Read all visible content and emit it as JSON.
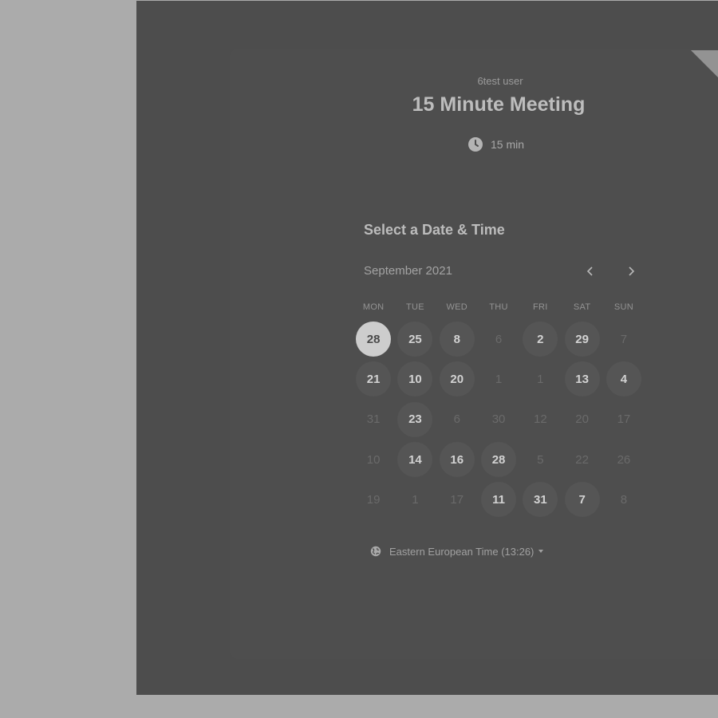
{
  "header": {
    "user_name": "6test user",
    "event_title": "15 Minute Meeting",
    "duration": "15 min"
  },
  "calendar": {
    "section_title": "Select a Date & Time",
    "month_label": "September 2021",
    "weekdays": [
      "MON",
      "TUE",
      "WED",
      "THU",
      "FRI",
      "SAT",
      "SUN"
    ],
    "days": [
      {
        "label": "28",
        "state": "selected"
      },
      {
        "label": "25",
        "state": "available"
      },
      {
        "label": "8",
        "state": "available"
      },
      {
        "label": "6",
        "state": "unavailable"
      },
      {
        "label": "2",
        "state": "available"
      },
      {
        "label": "29",
        "state": "available"
      },
      {
        "label": "7",
        "state": "unavailable"
      },
      {
        "label": "21",
        "state": "available"
      },
      {
        "label": "10",
        "state": "available"
      },
      {
        "label": "20",
        "state": "available"
      },
      {
        "label": "1",
        "state": "unavailable"
      },
      {
        "label": "1",
        "state": "unavailable"
      },
      {
        "label": "13",
        "state": "available"
      },
      {
        "label": "4",
        "state": "available"
      },
      {
        "label": "31",
        "state": "unavailable"
      },
      {
        "label": "23",
        "state": "available"
      },
      {
        "label": "6",
        "state": "unavailable"
      },
      {
        "label": "30",
        "state": "unavailable"
      },
      {
        "label": "12",
        "state": "unavailable"
      },
      {
        "label": "20",
        "state": "unavailable"
      },
      {
        "label": "17",
        "state": "unavailable"
      },
      {
        "label": "10",
        "state": "unavailable"
      },
      {
        "label": "14",
        "state": "available"
      },
      {
        "label": "16",
        "state": "available"
      },
      {
        "label": "28",
        "state": "available"
      },
      {
        "label": "5",
        "state": "unavailable"
      },
      {
        "label": "22",
        "state": "unavailable"
      },
      {
        "label": "26",
        "state": "unavailable"
      },
      {
        "label": "19",
        "state": "unavailable"
      },
      {
        "label": "1",
        "state": "unavailable"
      },
      {
        "label": "17",
        "state": "unavailable"
      },
      {
        "label": "11",
        "state": "available"
      },
      {
        "label": "31",
        "state": "available"
      },
      {
        "label": "7",
        "state": "available"
      },
      {
        "label": "8",
        "state": "unavailable"
      }
    ]
  },
  "timezone": {
    "label": "Eastern European Time (13:26)"
  },
  "icons": {
    "duration": "clock-icon",
    "prev": "chevron-left-icon",
    "next": "chevron-right-icon",
    "timezone": "globe-icon",
    "dropdown": "caret-down-icon"
  },
  "colors": {
    "page_background": "#ababab",
    "panel_background": "#4d4d4d",
    "selected_day": "#cdcdcd",
    "available_day": "#555555"
  }
}
